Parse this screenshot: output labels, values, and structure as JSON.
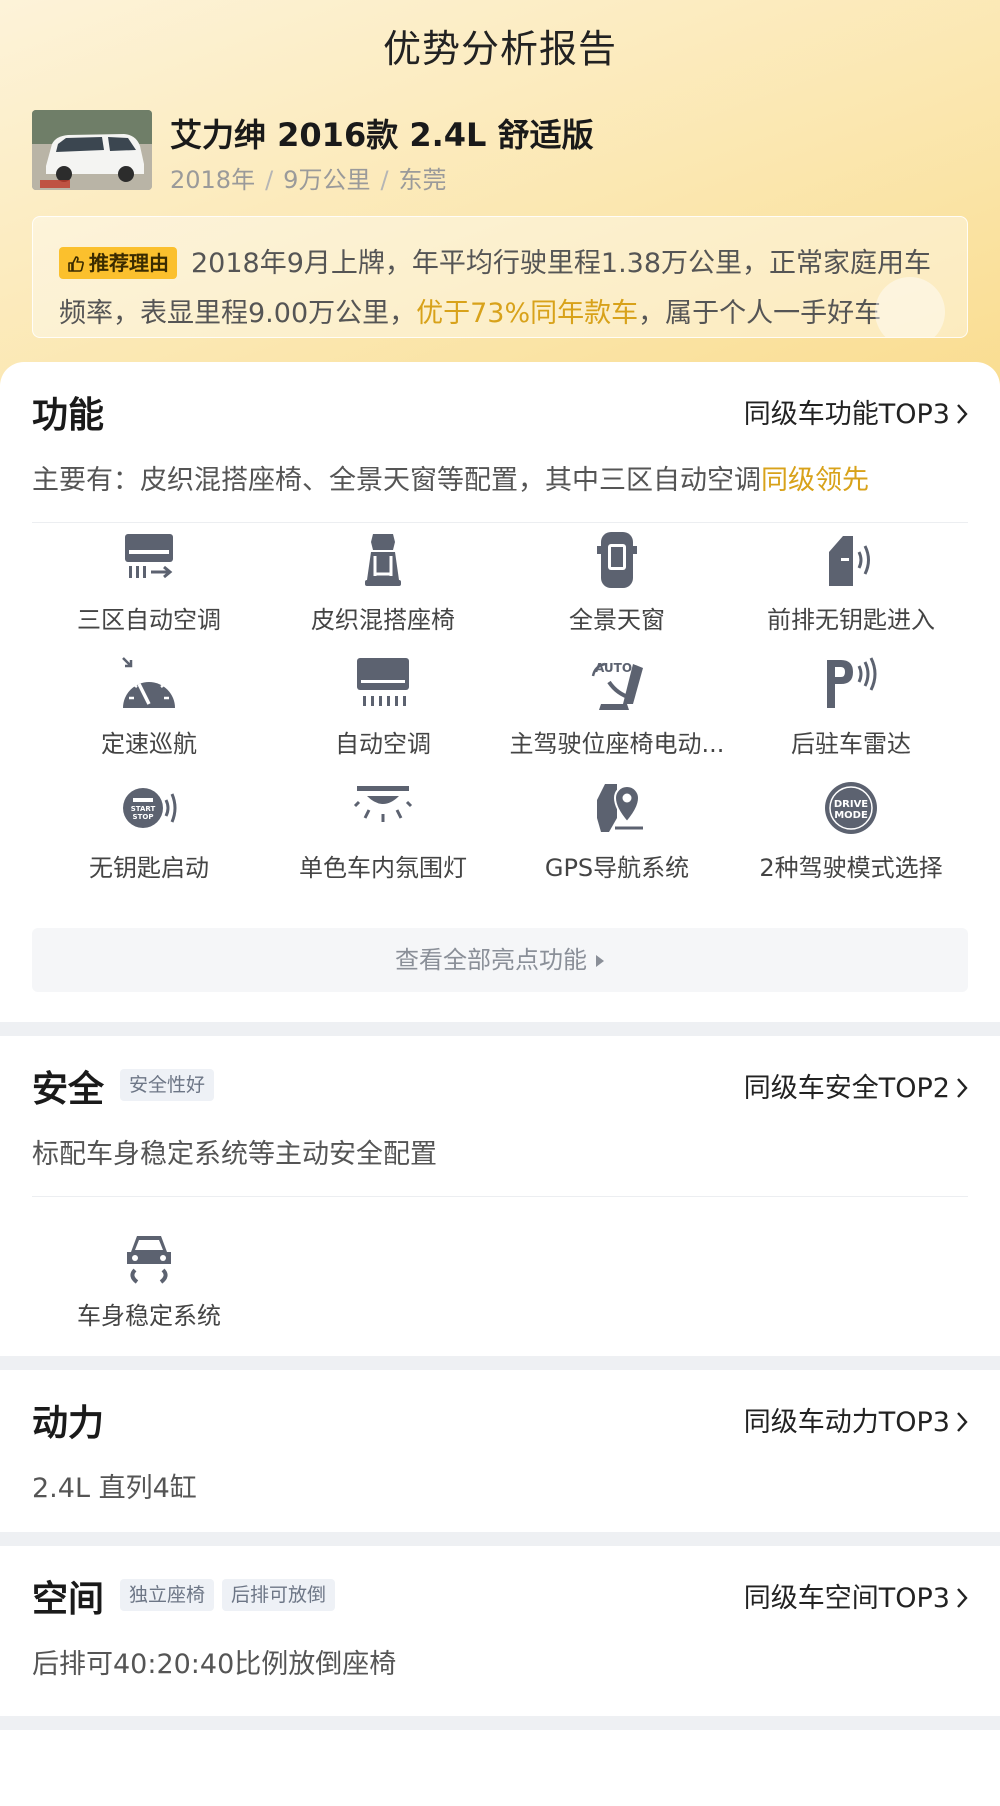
{
  "page": {
    "title": "优势分析报告"
  },
  "car": {
    "title": "艾力绅 2016款 2.4L 舒适版",
    "year": "2018年",
    "mileage": "9万公里",
    "city": "东莞",
    "separator": "/"
  },
  "reason": {
    "tag": "推荐理由",
    "text_before": "2018年9月上牌，年平均行驶里程1.38万公里，正常家庭用车频率，表显里程9.00万公里，",
    "highlight": "优于73%同年款车",
    "text_after": "，属于个人一手好车"
  },
  "function": {
    "title": "功能",
    "link": "同级车功能TOP3",
    "desc_prefix": "主要有：皮织混搭座椅、全景天窗等配置，其中三区自动空调",
    "desc_highlight": "同级领先",
    "features": [
      {
        "label": "三区自动空调",
        "icon": "three-zone-ac-icon"
      },
      {
        "label": "皮织混搭座椅",
        "icon": "seat-icon"
      },
      {
        "label": "全景天窗",
        "icon": "sunroof-icon"
      },
      {
        "label": "前排无钥匙进入",
        "icon": "keyless-entry-icon"
      },
      {
        "label": "定速巡航",
        "icon": "cruise-control-icon"
      },
      {
        "label": "自动空调",
        "icon": "auto-ac-icon"
      },
      {
        "label": "主驾驶位座椅电动...",
        "icon": "power-seat-icon"
      },
      {
        "label": "后驻车雷达",
        "icon": "parking-radar-icon"
      },
      {
        "label": "无钥匙启动",
        "icon": "keyless-start-icon"
      },
      {
        "label": "单色车内氛围灯",
        "icon": "ambient-light-icon"
      },
      {
        "label": "GPS导航系统",
        "icon": "gps-icon"
      },
      {
        "label": "2种驾驶模式选择",
        "icon": "drive-mode-icon"
      }
    ],
    "more": "查看全部亮点功能",
    "icon_text": {
      "auto": "AUTO",
      "start": "START",
      "stop": "STOP",
      "drive": "DRIVE",
      "mode": "MODE"
    }
  },
  "safety": {
    "title": "安全",
    "tags": [
      "安全性好"
    ],
    "link": "同级车安全TOP2",
    "desc": "标配车身稳定系统等主动安全配置",
    "features": [
      {
        "label": "车身稳定系统",
        "icon": "stability-control-icon"
      }
    ]
  },
  "power": {
    "title": "动力",
    "link": "同级车动力TOP3",
    "desc": "2.4L 直列4缸"
  },
  "space": {
    "title": "空间",
    "tags": [
      "独立座椅",
      "后排可放倒"
    ],
    "link": "同级车空间TOP3",
    "desc": "后排可40:20:40比例放倒座椅"
  },
  "colors": {
    "accent": "#d8a21a",
    "tag_bg": "#fbc02d",
    "icon": "#5c6270"
  }
}
